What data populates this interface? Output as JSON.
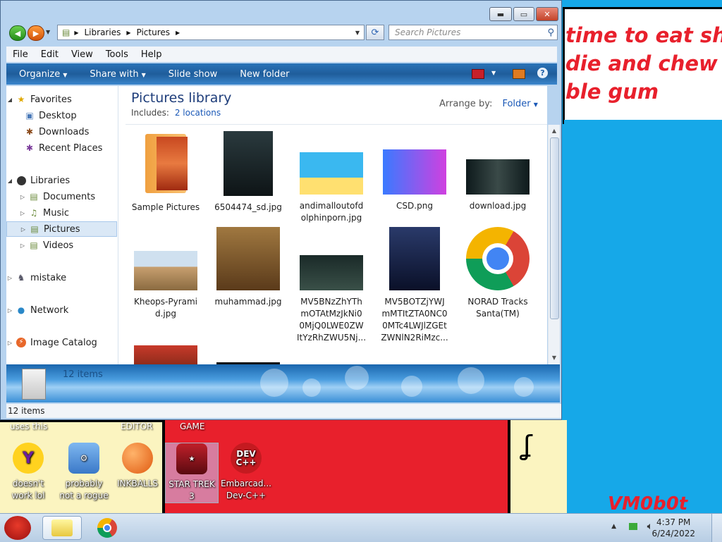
{
  "wallpaper": {
    "speech_text": "time to eat shit\ndie and chew\nble gum",
    "signature": "VM0b0t",
    "top_labels": [
      "uses this",
      "EDITOR",
      "GAME"
    ],
    "desktop_icons": [
      {
        "label": "doesn't work lol",
        "icon": "yahoo-messenger-icon"
      },
      {
        "label": "probably not a rogue",
        "icon": "system-control-icon"
      },
      {
        "label": "INKBALLS",
        "icon": "inkball-icon"
      },
      {
        "label": "STAR TREK 3",
        "icon": "star-trek-icon"
      },
      {
        "label": "Embarcad... Dev-C++",
        "icon": "dev-cpp-icon"
      }
    ]
  },
  "explorer": {
    "breadcrumb": [
      "Libraries",
      "Pictures"
    ],
    "search_placeholder": "Search Pictures",
    "menu": [
      "File",
      "Edit",
      "View",
      "Tools",
      "Help"
    ],
    "toolbar": [
      "Organize",
      "Share with",
      "Slide show",
      "New folder"
    ],
    "nav": {
      "favorites": "Favorites",
      "favorites_items": [
        "Desktop",
        "Downloads",
        "Recent Places"
      ],
      "libraries": "Libraries",
      "libraries_items": [
        "Documents",
        "Music",
        "Pictures",
        "Videos"
      ],
      "other": [
        "mistake",
        "Network",
        "Image Catalog"
      ]
    },
    "library_title": "Pictures library",
    "includes_label": "Includes:",
    "includes_link": "2 locations",
    "arrange_label": "Arrange by:",
    "arrange_value": "Folder",
    "files": [
      {
        "name": "Sample Pictures",
        "kind": "folder"
      },
      {
        "name": "6504474_sd.jpg",
        "kind": "image"
      },
      {
        "name": "andimalloutofd olphinporn.jpg",
        "kind": "image"
      },
      {
        "name": "CSD.png",
        "kind": "image"
      },
      {
        "name": "download.jpg",
        "kind": "image"
      },
      {
        "name": "Kheops-Pyrami d.jpg",
        "kind": "image"
      },
      {
        "name": "muhammad.jpg",
        "kind": "image"
      },
      {
        "name": "MV5BNzZhYTh mOTAtMzJkNi0 0MjQ0LWE0ZW ItYzRhZWU5Nj...",
        "kind": "image"
      },
      {
        "name": "MV5BOTZjYWJ mMTItZTA0NC0 0MTc4LWJlZGEt ZWNlN2RiMzc...",
        "kind": "image"
      },
      {
        "name": "NORAD Tracks Santa(TM)",
        "kind": "shortcut"
      }
    ],
    "details_count": "12 items",
    "status_count": "12 items"
  },
  "taskbar": {
    "time": "4:37 PM",
    "date": "6/24/2022"
  }
}
